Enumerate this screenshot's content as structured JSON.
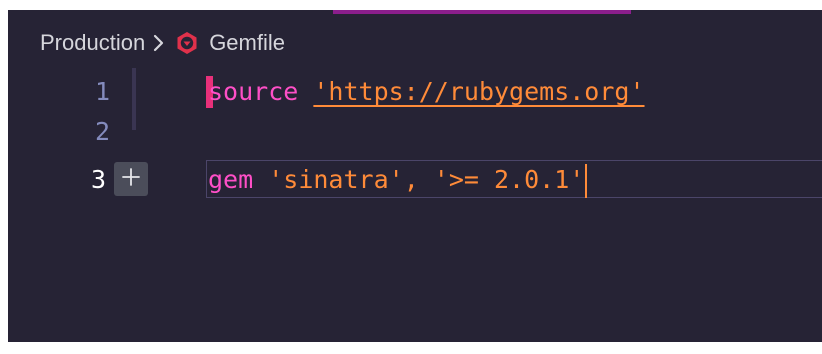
{
  "breadcrumb": {
    "folder": "Production",
    "file": "Gemfile"
  },
  "editor": {
    "lines": [
      {
        "number": "1",
        "keyword": "source",
        "space": " ",
        "string": "'https://rubygems.org'"
      },
      {
        "number": "2"
      },
      {
        "number": "3",
        "keyword": "gem",
        "space": " ",
        "string1": "'sinatra'",
        "comma": ", ",
        "string2": "'>= 2.0.1'"
      }
    ],
    "current_line": "3"
  },
  "colors": {
    "background": "#262335",
    "keyword": "#fe4fc7",
    "string": "#ff8b39",
    "accent_bar": "#8b1e8c",
    "ruby_icon": "#e0314b"
  },
  "icons": {
    "separator": "chevron-right-icon",
    "file_type": "ruby-gem-icon",
    "add_line": "plus-icon"
  }
}
